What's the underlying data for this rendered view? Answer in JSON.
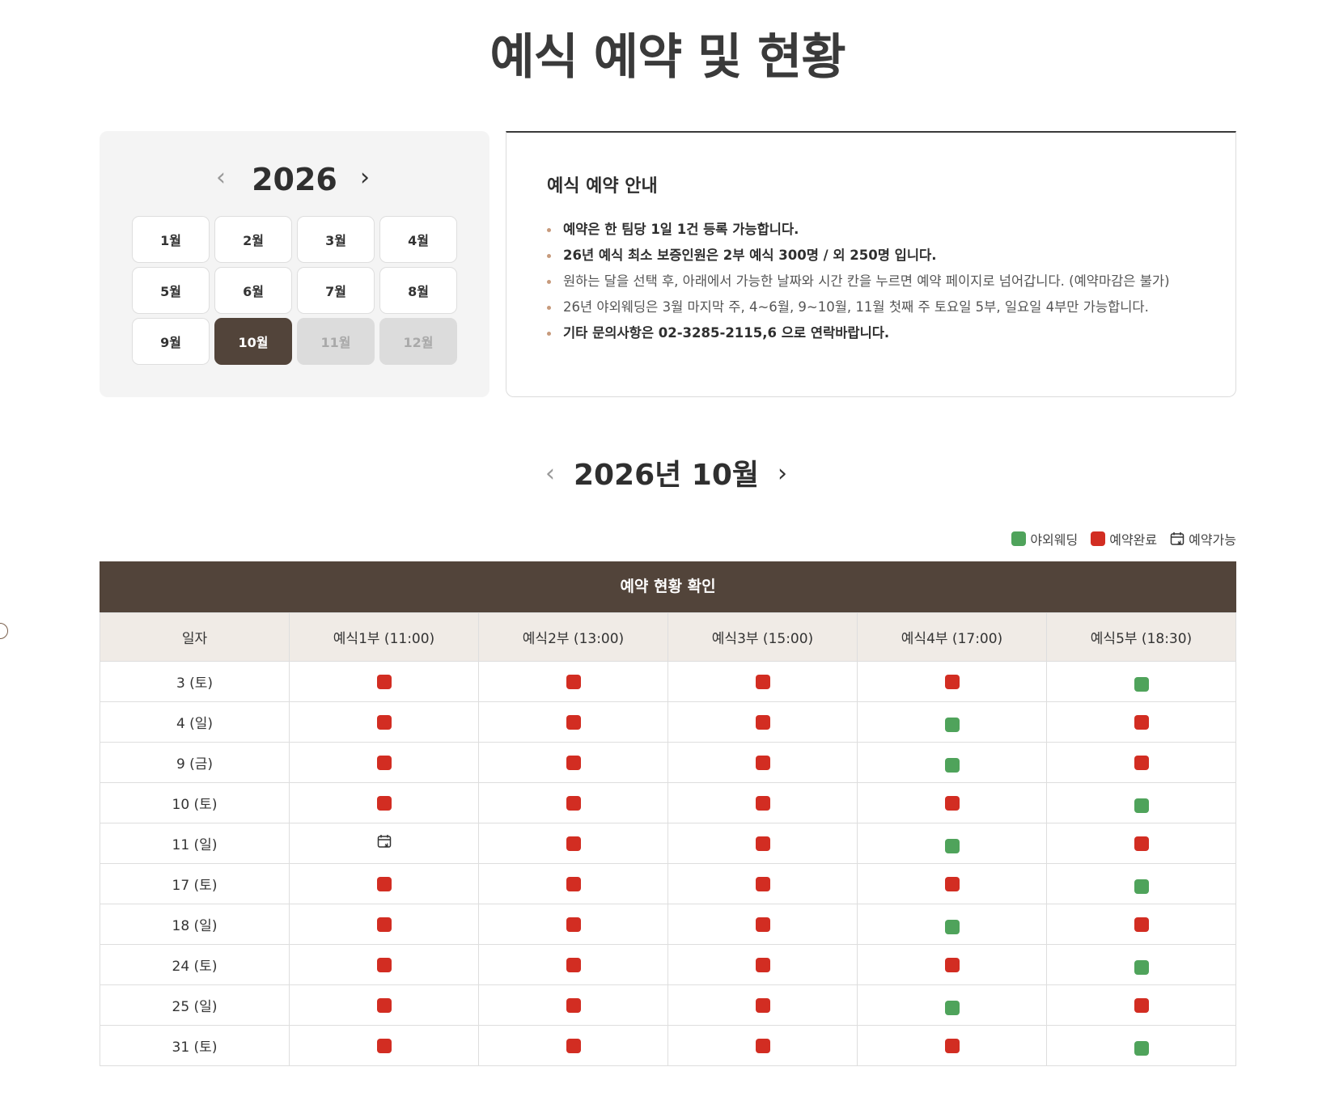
{
  "page_title": "예식 예약 및 현황",
  "year_picker": {
    "year": "2026",
    "months": [
      {
        "label": "1월",
        "state": "normal"
      },
      {
        "label": "2월",
        "state": "normal"
      },
      {
        "label": "3월",
        "state": "normal"
      },
      {
        "label": "4월",
        "state": "normal"
      },
      {
        "label": "5월",
        "state": "normal"
      },
      {
        "label": "6월",
        "state": "normal"
      },
      {
        "label": "7월",
        "state": "normal"
      },
      {
        "label": "8월",
        "state": "normal"
      },
      {
        "label": "9월",
        "state": "normal"
      },
      {
        "label": "10월",
        "state": "active"
      },
      {
        "label": "11월",
        "state": "disabled"
      },
      {
        "label": "12월",
        "state": "disabled"
      }
    ]
  },
  "info": {
    "title": "예식 예약 안내",
    "items": [
      {
        "text": "예약은 한 팀당 1일 1건 등록 가능합니다.",
        "strong": true
      },
      {
        "text": "26년 예식 최소 보증인원은 2부 예식 300명 / 외 250명 입니다.",
        "strong": true
      },
      {
        "text": "원하는 달을 선택 후, 아래에서 가능한 날짜와 시간 칸을 누르면 예약 페이지로 넘어갑니다. (예약마감은 불가)",
        "strong": false
      },
      {
        "text": "26년 야외웨딩은 3월 마지막 주, 4~6월, 9~10월, 11월 첫째 주 토요일 5부, 일요일 4부만 가능합니다.",
        "strong": false
      },
      {
        "text": "기타 문의사항은 02-3285-2115,6 으로 연락바랍니다.",
        "strong": true
      }
    ]
  },
  "month_nav": {
    "label": "2026년 10월"
  },
  "legend": {
    "outdoor": "야외웨딩",
    "booked": "예약완료",
    "available": "예약가능"
  },
  "colors": {
    "outdoor": "#4fa35b",
    "booked": "#d22d22",
    "brand": "#52443a"
  },
  "table": {
    "title": "예약 현황 확인",
    "columns": [
      "일자",
      "예식1부 (11:00)",
      "예식2부 (13:00)",
      "예식3부 (15:00)",
      "예식4부 (17:00)",
      "예식5부 (18:30)"
    ],
    "rows": [
      {
        "date": "3 (토)",
        "slots": [
          "booked",
          "booked",
          "booked",
          "booked",
          "outdoor"
        ]
      },
      {
        "date": "4 (일)",
        "slots": [
          "booked",
          "booked",
          "booked",
          "outdoor",
          "booked"
        ]
      },
      {
        "date": "9 (금)",
        "slots": [
          "booked",
          "booked",
          "booked",
          "outdoor",
          "booked"
        ]
      },
      {
        "date": "10 (토)",
        "slots": [
          "booked",
          "booked",
          "booked",
          "booked",
          "outdoor"
        ]
      },
      {
        "date": "11 (일)",
        "slots": [
          "available",
          "booked",
          "booked",
          "outdoor",
          "booked"
        ]
      },
      {
        "date": "17 (토)",
        "slots": [
          "booked",
          "booked",
          "booked",
          "booked",
          "outdoor"
        ]
      },
      {
        "date": "18 (일)",
        "slots": [
          "booked",
          "booked",
          "booked",
          "outdoor",
          "booked"
        ]
      },
      {
        "date": "24 (토)",
        "slots": [
          "booked",
          "booked",
          "booked",
          "booked",
          "outdoor"
        ]
      },
      {
        "date": "25 (일)",
        "slots": [
          "booked",
          "booked",
          "booked",
          "outdoor",
          "booked"
        ]
      },
      {
        "date": "31 (토)",
        "slots": [
          "booked",
          "booked",
          "booked",
          "booked",
          "outdoor"
        ]
      }
    ]
  }
}
